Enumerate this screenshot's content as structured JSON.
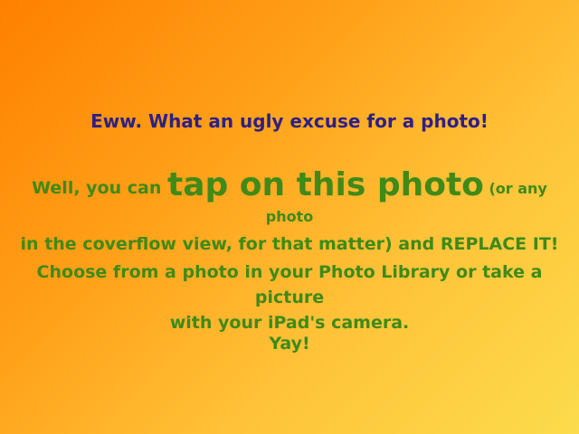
{
  "headline": "Eww. What an ugly excuse for a photo!",
  "instructions": {
    "lead": "Well, you can ",
    "emphasis": "tap on this photo",
    "aside": " (or any photo",
    "line2": "in the coverflow view, for that matter) and REPLACE IT!"
  },
  "choose": {
    "line1": "Choose from a photo in your Photo Library or take a picture",
    "line2": "with your iPad's camera."
  },
  "yay": "Yay!",
  "colors": {
    "background_start": "#ff8000",
    "background_end": "#fcdc4c",
    "headline": "#2e1f88",
    "body": "#3f8a18"
  }
}
